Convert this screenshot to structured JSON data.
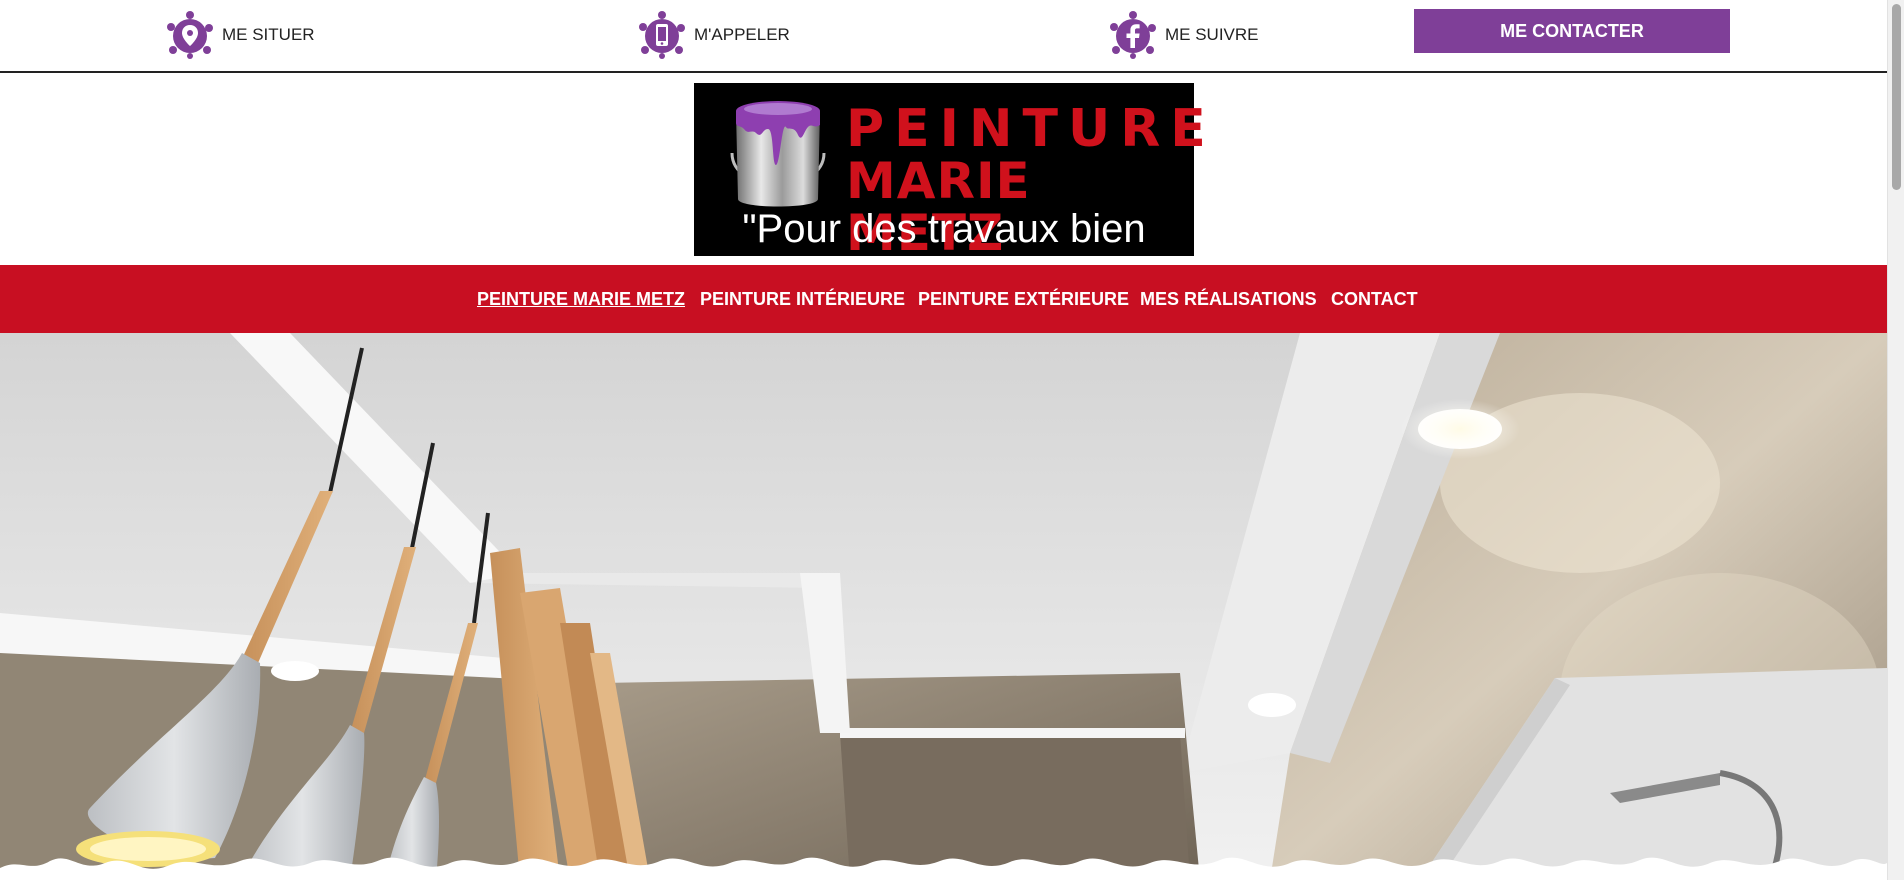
{
  "topbar": {
    "links": [
      {
        "label": "ME SITUER",
        "icon": "location-pin-icon"
      },
      {
        "label": "M'APPELER",
        "icon": "phone-icon"
      },
      {
        "label": "ME SUIVRE",
        "icon": "facebook-icon"
      }
    ],
    "contact_button": "ME CONTACTER"
  },
  "logo": {
    "line1": "PEINTURE",
    "line2": "MARIE METZ",
    "tagline": "\"Pour des travaux bien faits\""
  },
  "nav": {
    "items": [
      {
        "label": "PEINTURE MARIE METZ",
        "active": true
      },
      {
        "label": "PEINTURE INTÉRIEURE",
        "active": false
      },
      {
        "label": "PEINTURE EXTÉRIEURE",
        "active": false
      },
      {
        "label": "MES RÉALISATIONS",
        "active": false
      },
      {
        "label": "CONTACT",
        "active": false
      }
    ]
  },
  "colors": {
    "brand_purple": "#7f3f98",
    "brand_red": "#c80f22",
    "logo_red": "#d0111c"
  }
}
